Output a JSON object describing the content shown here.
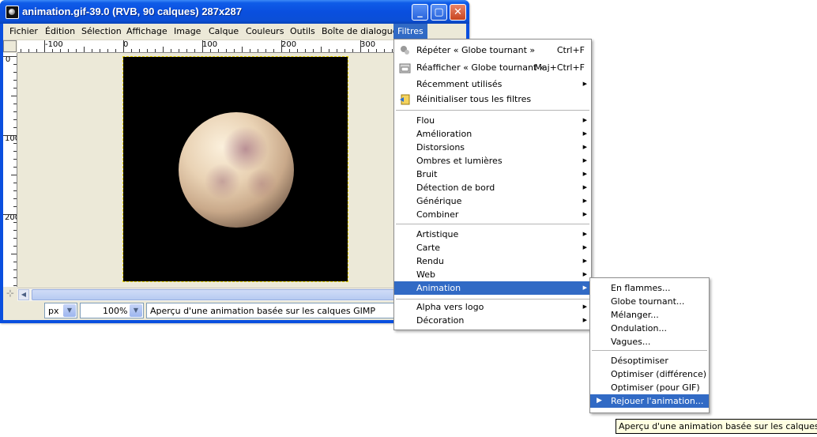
{
  "window": {
    "title": "animation.gif-39.0 (RVB, 90 calques) 287x287",
    "buttons": [
      "_",
      "▢",
      "✕"
    ]
  },
  "menubar": {
    "items": [
      "Fichier",
      "Édition",
      "Sélection",
      "Affichage",
      "Image",
      "Calque",
      "Couleurs",
      "Outils",
      "Boîte de dialogue",
      "Filtres"
    ],
    "active": "Filtres"
  },
  "ruler": {
    "h_labels": [
      "-100",
      "0",
      "100",
      "200",
      "300"
    ],
    "v_labels": [
      "0",
      "100",
      "200"
    ]
  },
  "statusbar": {
    "unit": "px",
    "zoom": "100%",
    "message": "Aperçu d'une animation basée sur les calques GIMP"
  },
  "filters_menu": {
    "group1": [
      {
        "label": "Répéter « Globe tournant »",
        "accel": "Ctrl+F",
        "icon": "repeat-icon"
      },
      {
        "label": "Réafficher « Globe tournant »",
        "accel": "Maj+Ctrl+F",
        "icon": "reshow-icon"
      },
      {
        "label": "Récemment utilisés",
        "accel": "",
        "icon": "",
        "submenu": true
      },
      {
        "label": "Réinitialiser tous les filtres",
        "accel": "",
        "icon": "reset-icon"
      }
    ],
    "group2": [
      "Flou",
      "Amélioration",
      "Distorsions",
      "Ombres et lumières",
      "Bruit",
      "Détection de bord",
      "Générique",
      "Combiner"
    ],
    "group3": [
      "Artistique",
      "Carte",
      "Rendu",
      "Web",
      "Animation"
    ],
    "group4": [
      "Alpha vers logo",
      "Décoration"
    ],
    "highlighted": "Animation",
    "submenu_arrow": "▶"
  },
  "animation_submenu": {
    "group1": [
      "En flammes...",
      "Globe tournant...",
      "Mélanger...",
      "Ondulation...",
      "Vagues..."
    ],
    "group2": [
      "Désoptimiser",
      "Optimiser (différence)",
      "Optimiser (pour GIF)",
      "Rejouer l'animation..."
    ],
    "highlighted": "Rejouer l'animation...",
    "play_glyph": "▶"
  },
  "tooltip": "Aperçu d'une animation basée sur les calques GIMP",
  "colors": {
    "title_blue": "#0a4fdf",
    "highlight": "#316ac5",
    "window_bg": "#ece9d8"
  }
}
